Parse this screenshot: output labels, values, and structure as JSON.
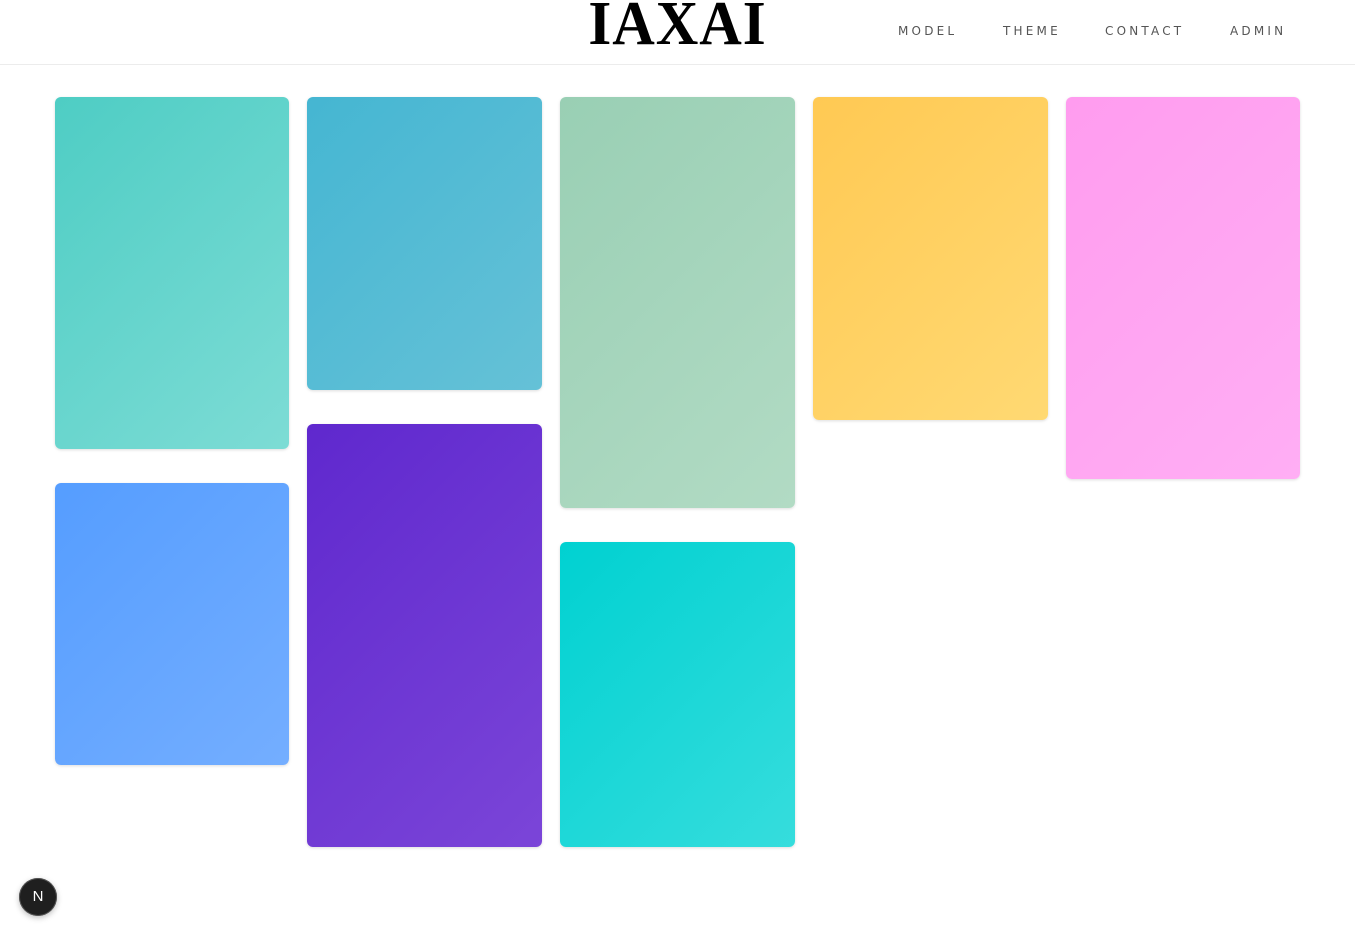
{
  "header": {
    "logo": "IAXAI",
    "nav": [
      "MODEL",
      "THEME",
      "CONTACT",
      "ADMIN"
    ]
  },
  "cards": {
    "colors": [
      [
        "#4ecdc4",
        "#7ddcd5"
      ],
      [
        "#559dff",
        "#74aeff"
      ],
      [
        "#45b6d2",
        "#65c1d7"
      ],
      [
        "#5f28ce",
        "#7b45d8"
      ],
      [
        "#99cfb4",
        "#b2dbc4"
      ],
      [
        "#00d1d1",
        "#36dddd"
      ],
      [
        "#ffc953",
        "#ffd973"
      ],
      [
        "#ff9cef",
        "#ffaef4"
      ]
    ]
  },
  "dev_badge": {
    "label": "N"
  }
}
